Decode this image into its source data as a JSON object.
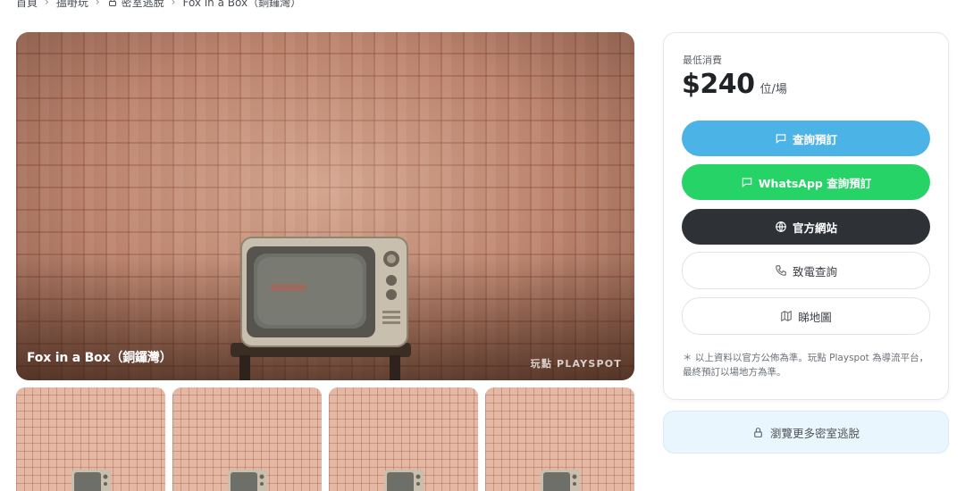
{
  "breadcrumb": {
    "items": [
      "首頁",
      "搵嘢玩",
      "密室逃脫",
      "Fox in a Box（銅鑼灣）"
    ]
  },
  "hero": {
    "title": "Fox in a Box（銅鑼灣）",
    "watermark": "玩點 PLAYSPOT"
  },
  "thumbnails": {
    "count": 4
  },
  "pricing": {
    "label": "最低消費",
    "price": "$240",
    "unit": "位/場"
  },
  "actions": {
    "enquiry": "查詢預訂",
    "whatsapp": "WhatsApp 查詢預訂",
    "website": "官方網站",
    "call": "致電查詢",
    "map": "睇地圖"
  },
  "note": "＊ 以上資料以官方公佈為準。玩點 Playspot 為導流平台，最終預訂以場地方為準。",
  "browse_more": "瀏覽更多密室逃脫",
  "colors": {
    "enquiry": "#4cb3e6",
    "whatsapp": "#26d366",
    "website": "#2e3236",
    "browse_bg": "#eaf6fd"
  }
}
